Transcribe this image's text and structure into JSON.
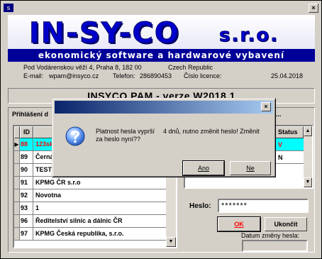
{
  "window": {
    "close_glyph": "×",
    "system_icon": "s"
  },
  "banner": {
    "logo_main": "IN-SY-CO",
    "logo_suffix": "s.r.o.",
    "tagline": "ekonomický software a hardwarové vybavení"
  },
  "company": {
    "address_line": "Pod Vodárenskou věží 4, Praha  8, 182 00",
    "country": "Czech Republic",
    "email_label": "E-mail:",
    "email": "wpam@insyco.cz",
    "phone_label": "Telefon:",
    "phone": "286890453",
    "license_label": "Číslo licence:",
    "date": "25.04.2018"
  },
  "app_title": "INSYCO PAM -   verze  W2018.1",
  "login": {
    "group_label": "Přihlášení d",
    "group_label_right": "...",
    "columns": {
      "id": "ID",
      "status": "Status"
    },
    "rows": [
      {
        "id": "88",
        "name": "123sk",
        "selected": true
      },
      {
        "id": "89",
        "name": "Černá"
      },
      {
        "id": "90",
        "name": "TEST_"
      },
      {
        "id": "91",
        "name": "KPMG  ČR s.r.o"
      },
      {
        "id": "92",
        "name": "Novotna"
      },
      {
        "id": "93",
        "name": "1"
      },
      {
        "id": "96",
        "name": "Ředitelství silnic a dálnic ČR"
      },
      {
        "id": "97",
        "name": "KPMG Česká republika, s.r.o."
      }
    ],
    "user_rows": [
      {
        "status": "V",
        "selected": true
      },
      {
        "status": "N"
      }
    ],
    "password_label": "Heslo:",
    "password_value": "*******",
    "ok_label": "OK",
    "quit_label": "Ukončit",
    "pw_change_date_label": "Datum změny hesla:"
  },
  "dialog": {
    "message_part1": "Platnost hesla vyprší za heslo nyní??",
    "message_part2": "4 dnů, nutno změnit heslo! Změnit",
    "yes_label": "Ano",
    "no_label": "Ne",
    "close_glyph": "×"
  },
  "colors": {
    "selection_bg": "#00ffff",
    "selection_fg": "#ff0000",
    "brand_blue": "#0000cc",
    "tagline_bg": "#000099"
  }
}
